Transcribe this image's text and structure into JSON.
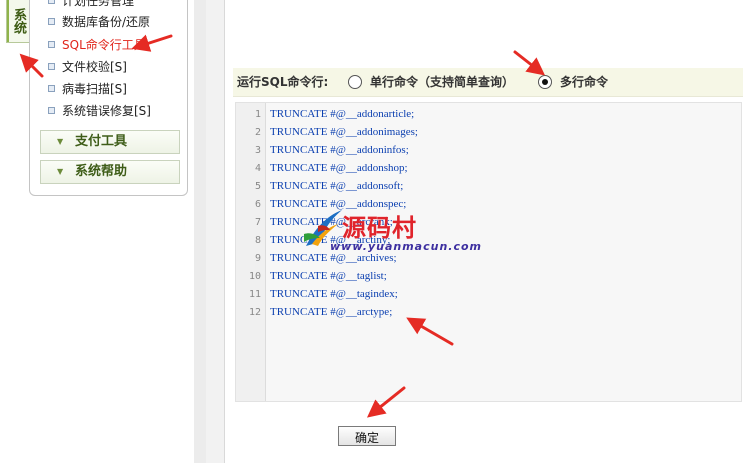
{
  "sidebar": {
    "vertical_tab": "系统",
    "items": [
      {
        "label": "计划任务管理"
      },
      {
        "label": "数据库备份/还原"
      },
      {
        "label": "SQL命令行工具",
        "active": true
      },
      {
        "label": "文件校验[S]"
      },
      {
        "label": "病毒扫描[S]"
      },
      {
        "label": "系统错误修复[S]"
      }
    ],
    "groups": [
      {
        "label": "支付工具"
      },
      {
        "label": "系统帮助"
      }
    ]
  },
  "run_mode": {
    "label": "运行SQL命令行:",
    "options": [
      {
        "label": "单行命令（支持简单查询）",
        "checked": false
      },
      {
        "label": "多行命令",
        "checked": true
      }
    ]
  },
  "editor": {
    "lines": [
      {
        "num": "1",
        "text": "TRUNCATE #@__addonarticle;"
      },
      {
        "num": "2",
        "text": "TRUNCATE #@__addonimages;"
      },
      {
        "num": "3",
        "text": "TRUNCATE #@__addoninfos;"
      },
      {
        "num": "4",
        "text": "TRUNCATE #@__addonshop;"
      },
      {
        "num": "5",
        "text": "TRUNCATE #@__addonsoft;"
      },
      {
        "num": "6",
        "text": "TRUNCATE #@__addonspec;"
      },
      {
        "num": "7",
        "text": "TRUNCATE #@__arcrank;"
      },
      {
        "num": "8",
        "text": "TRUNCATE #@__arctiny;"
      },
      {
        "num": "9",
        "text": "TRUNCATE #@__archives;"
      },
      {
        "num": "10",
        "text": "TRUNCATE #@__taglist;"
      },
      {
        "num": "11",
        "text": "TRUNCATE #@__tagindex;"
      },
      {
        "num": "12",
        "text": "TRUNCATE #@__arctype;"
      }
    ]
  },
  "submit_label": "确定",
  "watermark": {
    "title": "源码村",
    "url": "www.yuanmacun.com"
  },
  "colors": {
    "active_menu": "#e1261c",
    "code_text": "#0b3fb0",
    "arrow": "#e52b24",
    "run_row_bg": "#f6f7e6"
  }
}
